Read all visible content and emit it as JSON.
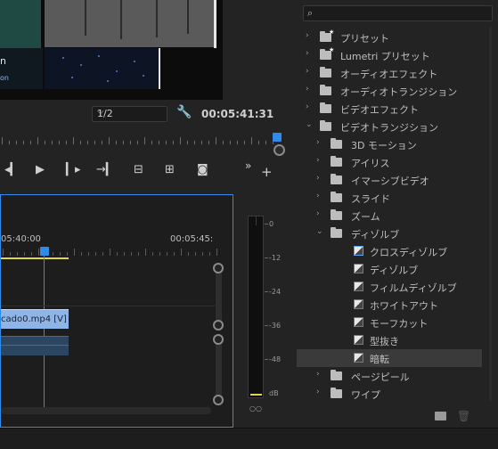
{
  "monitor": {
    "video_text": "n",
    "video_subtext": "on",
    "resolution": "1/2",
    "timecode": "00:05:41:31"
  },
  "timeline": {
    "time_start": "05:40:00",
    "time_end": "00:05:45:",
    "clip_label": "cado0.mp4 [V]"
  },
  "meter": {
    "labels": [
      "0",
      "-12",
      "-24",
      "-36",
      "-48",
      "dB"
    ],
    "bottom": "○○"
  },
  "effects": {
    "search": {
      "placeholder": "",
      "value": ""
    },
    "items": [
      {
        "label": "プリセット",
        "icon": "star-folder"
      },
      {
        "label": "Lumetri プリセット",
        "icon": "star-folder"
      },
      {
        "label": "オーディオエフェクト",
        "icon": "folder"
      },
      {
        "label": "オーディオトランジション",
        "icon": "folder"
      },
      {
        "label": "ビデオエフェクト",
        "icon": "folder"
      },
      {
        "label": "ビデオトランジション",
        "icon": "folder"
      },
      {
        "label": "3D モーション",
        "icon": "folder"
      },
      {
        "label": "アイリス",
        "icon": "folder"
      },
      {
        "label": "イマーシブビデオ",
        "icon": "folder"
      },
      {
        "label": "スライド",
        "icon": "folder"
      },
      {
        "label": "ズーム",
        "icon": "folder"
      },
      {
        "label": "ディゾルブ",
        "icon": "folder"
      },
      {
        "label": "クロスディゾルブ",
        "icon": "transition"
      },
      {
        "label": "ディゾルブ",
        "icon": "transition"
      },
      {
        "label": "フィルムディゾルブ",
        "icon": "transition"
      },
      {
        "label": "ホワイトアウト",
        "icon": "transition"
      },
      {
        "label": "モーフカット",
        "icon": "transition"
      },
      {
        "label": "型抜き",
        "icon": "transition"
      },
      {
        "label": "暗転",
        "icon": "transition"
      },
      {
        "label": "ページピール",
        "icon": "folder"
      },
      {
        "label": "ワイプ",
        "icon": "folder"
      }
    ]
  }
}
